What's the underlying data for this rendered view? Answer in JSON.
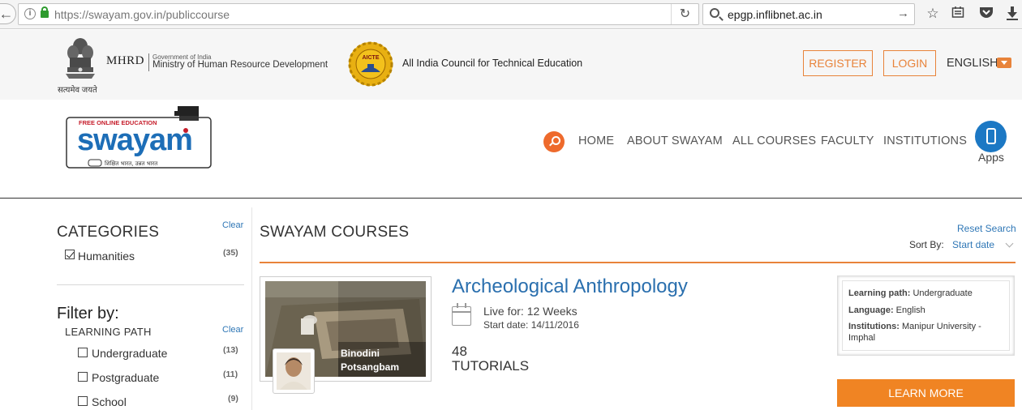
{
  "browser": {
    "url_host": "https://swayam.gov.in",
    "url_path": "/publiccourse",
    "search_text": "epgp.inflibnet.ac.in"
  },
  "gov_header": {
    "motto": "सत्यमेव जयते",
    "mhrd_abbr": "MHRD",
    "gov_of_india": "Government of India",
    "ministry": "Ministry of Human Resource Development",
    "aicte_badge": "AICTE",
    "aicte_name": "All India Council for Technical Education",
    "register_label": "REGISTER",
    "login_label": "LOGIN",
    "language": "ENGLISH"
  },
  "logo": {
    "tagline_top": "FREE ONLINE EDUCATION",
    "wordmark": "swayam",
    "tagline_bottom": "शिक्षित भारत, उन्नत भारत"
  },
  "nav": {
    "items": [
      "HOME",
      "ABOUT SWAYAM",
      "ALL COURSES",
      "FACULTY",
      "INSTITUTIONS"
    ],
    "apps_label": "Apps"
  },
  "sidebar": {
    "categories_title": "CATEGORIES",
    "clear_label": "Clear",
    "categories": [
      {
        "label": "Humanities",
        "count": "(35)",
        "checked": true
      }
    ],
    "filter_title": "Filter by:",
    "learning_path_title": "LEARNING PATH",
    "learning_path_clear": "Clear",
    "learning_paths": [
      {
        "label": "Undergraduate",
        "count": "(13)",
        "checked": false
      },
      {
        "label": "Postgraduate",
        "count": "(11)",
        "checked": false
      },
      {
        "label": "School",
        "count": "(9)",
        "checked": false
      }
    ]
  },
  "main": {
    "title": "SWAYAM COURSES",
    "reset_label": "Reset Search",
    "sort_label": "Sort By:",
    "sort_value": "Start date"
  },
  "course": {
    "title": "Archeological Anthropology",
    "instructor_line1": "Binodini",
    "instructor_line2": "Potsangbam",
    "live_for": "Live for: 12 Weeks",
    "start_date": "Start date: 14/11/2016",
    "tutorial_count": "48",
    "tutorial_label": "TUTORIALS",
    "info": {
      "learning_path_key": "Learning path:",
      "learning_path_val": " Undergraduate",
      "language_key": "Language:",
      "language_val": " English",
      "institutions_key": "Institutions:",
      "institutions_val": " Manipur University - Imphal"
    },
    "learn_more_label": "LEARN MORE"
  },
  "colors": {
    "accent_orange": "#e8833a",
    "link_blue": "#2f77b6",
    "apps_blue": "#1c78c4",
    "button_orange": "#f08423"
  }
}
